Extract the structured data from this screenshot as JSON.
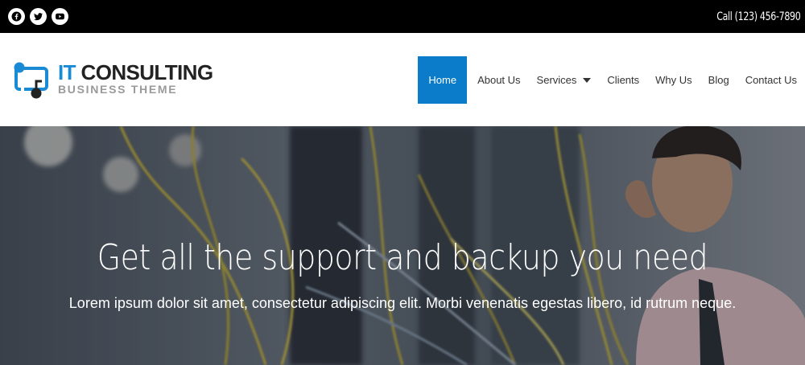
{
  "topbar": {
    "social": [
      {
        "icon": "facebook-icon"
      },
      {
        "icon": "twitter-icon"
      },
      {
        "icon": "youtube-icon"
      }
    ],
    "phone": "Call (123) 456-7890"
  },
  "logo": {
    "title_accent": "IT",
    "title_rest": " CONSULTING",
    "subtitle": "BUSINESS THEME",
    "colors": {
      "accent": "#1a8ad4",
      "dark": "#222222",
      "muted": "#9a9a9a"
    }
  },
  "nav": {
    "items": [
      {
        "label": "Home",
        "active": true
      },
      {
        "label": "About Us"
      },
      {
        "label": "Services",
        "has_dropdown": true
      },
      {
        "label": "Clients"
      },
      {
        "label": "Why Us"
      },
      {
        "label": "Blog"
      },
      {
        "label": "Contact Us"
      }
    ],
    "active_color": "#0b7cc9"
  },
  "hero": {
    "title": "Get all the support and backup you need",
    "subtitle": "Lorem ipsum dolor sit amet, consectetur adipiscing elit. Morbi venenatis egestas libero, id rutrum neque."
  }
}
